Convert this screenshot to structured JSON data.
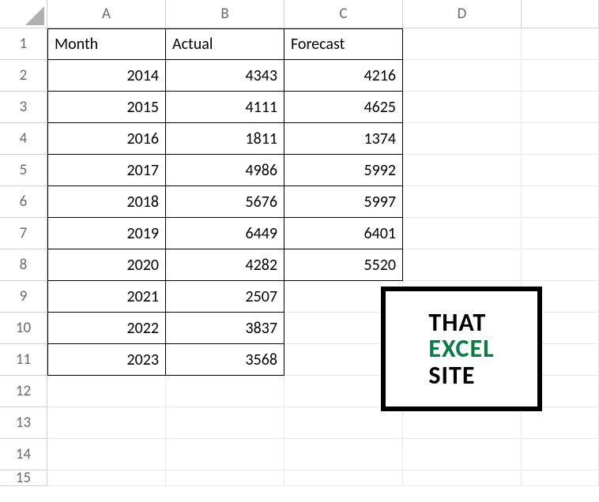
{
  "columns": [
    "A",
    "B",
    "C",
    "D",
    ""
  ],
  "row_numbers": [
    "1",
    "2",
    "3",
    "4",
    "5",
    "6",
    "7",
    "8",
    "9",
    "10",
    "11",
    "12",
    "13",
    "14",
    "15"
  ],
  "headers": {
    "a": "Month",
    "b": "Actual",
    "c": "Forecast"
  },
  "rows": [
    {
      "month": "2014",
      "actual": "4343",
      "forecast": "4216"
    },
    {
      "month": "2015",
      "actual": "4111",
      "forecast": "4625"
    },
    {
      "month": "2016",
      "actual": "1811",
      "forecast": "1374"
    },
    {
      "month": "2017",
      "actual": "4986",
      "forecast": "5992"
    },
    {
      "month": "2018",
      "actual": "5676",
      "forecast": "5997"
    },
    {
      "month": "2019",
      "actual": "6449",
      "forecast": "6401"
    },
    {
      "month": "2020",
      "actual": "4282",
      "forecast": "5520"
    },
    {
      "month": "2021",
      "actual": "2507",
      "forecast": ""
    },
    {
      "month": "2022",
      "actual": "3837",
      "forecast": ""
    },
    {
      "month": "2023",
      "actual": "3568",
      "forecast": ""
    }
  ],
  "logo": {
    "line1": "THAT",
    "line2": "EXCEL",
    "line3": "SITE"
  }
}
